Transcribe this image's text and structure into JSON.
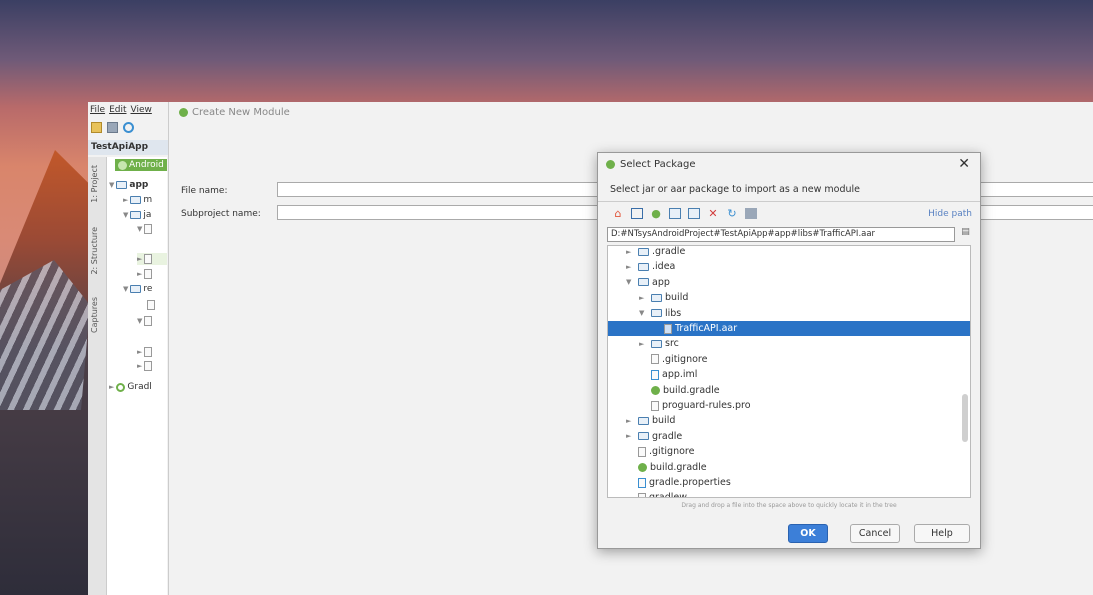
{
  "ide": {
    "menu": [
      "File",
      "Edit",
      "View"
    ],
    "project_header": "TestApiApp",
    "tree_first": "Android",
    "tree_app": "app",
    "tree_m": "m",
    "tree_ja": "ja",
    "tree_re": "re",
    "tree_gradle": "Gradl",
    "sidebar_tabs": [
      "1: Project",
      "2: Structure",
      "Captures"
    ]
  },
  "create_module": {
    "title": "Create New Module",
    "file_name_label": "File name:",
    "file_name_value": "",
    "subproject_label": "Subproject name:",
    "subproject_value": ""
  },
  "select_package": {
    "title": "Select Package",
    "close": "✕",
    "description": "Select jar or aar package to import as a new module",
    "hide_path": "Hide path",
    "path": "D:#NTsysAndroidProject#TestApiApp#app#libs#TrafficAPI.aar",
    "tree": [
      {
        "label": ".gradle",
        "type": "folder",
        "level": 3,
        "arrow": "►"
      },
      {
        "label": ".idea",
        "type": "folder",
        "level": 3,
        "arrow": "►"
      },
      {
        "label": "app",
        "type": "folder",
        "level": 3,
        "arrow": "▼"
      },
      {
        "label": "build",
        "type": "folder",
        "level": 4,
        "arrow": "►"
      },
      {
        "label": "libs",
        "type": "folder",
        "level": 4,
        "arrow": "▼"
      },
      {
        "label": "TrafficAPI.aar",
        "type": "file",
        "level": 5,
        "arrow": "",
        "selected": true
      },
      {
        "label": "src",
        "type": "folder",
        "level": 4,
        "arrow": "►"
      },
      {
        "label": ".gitignore",
        "type": "file",
        "level": 4,
        "arrow": ""
      },
      {
        "label": "app.iml",
        "type": "iml",
        "level": 4,
        "arrow": ""
      },
      {
        "label": "build.gradle",
        "type": "gradle",
        "level": 4,
        "arrow": ""
      },
      {
        "label": "proguard-rules.pro",
        "type": "file",
        "level": 4,
        "arrow": ""
      },
      {
        "label": "build",
        "type": "folder",
        "level": 3,
        "arrow": "►"
      },
      {
        "label": "gradle",
        "type": "folder",
        "level": 3,
        "arrow": "►"
      },
      {
        "label": ".gitignore",
        "type": "file",
        "level": 3,
        "arrow": ""
      },
      {
        "label": "build.gradle",
        "type": "gradle",
        "level": 3,
        "arrow": ""
      },
      {
        "label": "gradle.properties",
        "type": "iml",
        "level": 3,
        "arrow": ""
      },
      {
        "label": "gradlew",
        "type": "file",
        "level": 3,
        "arrow": ""
      }
    ],
    "drop_hint": "Drag and drop a file into the space above to quickly locate it in the tree",
    "ok_label": "OK",
    "cancel_label": "Cancel",
    "help_label": "Help"
  }
}
